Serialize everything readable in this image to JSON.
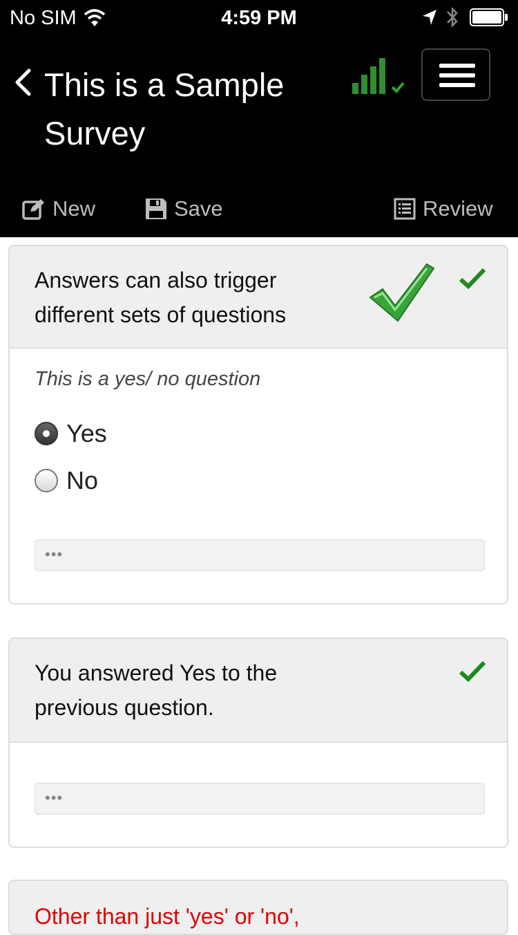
{
  "status_bar": {
    "carrier": "No SIM",
    "time": "4:59 PM",
    "icons": [
      "wifi-icon",
      "location-arrow-icon",
      "bluetooth-icon",
      "battery-icon"
    ]
  },
  "header": {
    "title": "This is a Sample Survey",
    "signal_status": "connected",
    "toolbar": {
      "new_label": "New",
      "save_label": "Save",
      "review_label": "Review"
    }
  },
  "questions": [
    {
      "title": "Answers can also trigger different sets of questions",
      "answered": true,
      "prompt": "This is a yes/ no question",
      "options": [
        {
          "label": "Yes",
          "selected": true
        },
        {
          "label": "No",
          "selected": false
        }
      ],
      "comment_placeholder": "•••"
    },
    {
      "title": "You answered Yes to the previous question.",
      "answered": true,
      "comment_placeholder": "•••"
    },
    {
      "title": "Other than just 'yes' or 'no',",
      "title_color": "#e00000"
    }
  ],
  "colors": {
    "header_bg": "#000000",
    "accent_green": "#1e8a1e",
    "toolbar_text": "#bdbdbd",
    "warning_red": "#e00000"
  }
}
